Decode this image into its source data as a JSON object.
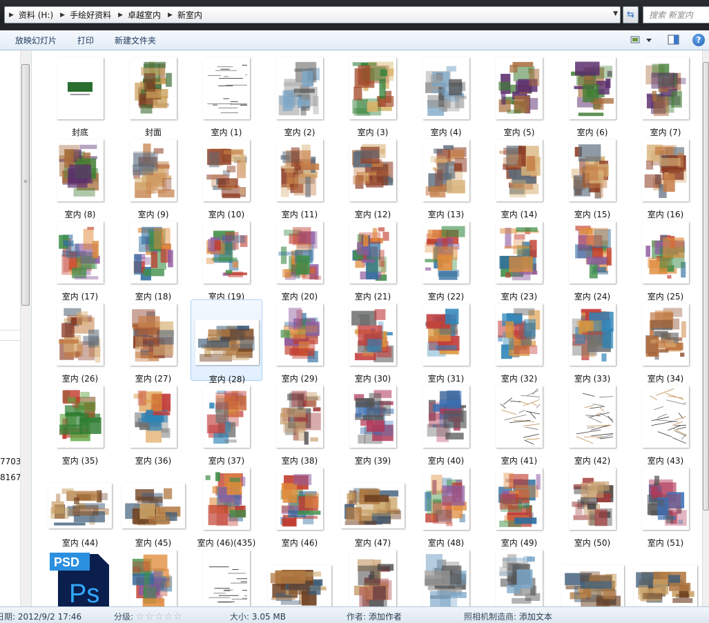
{
  "address": {
    "crumbs": [
      "资料 (H:)",
      "手绘好资料",
      "卓越室内",
      "新室内"
    ],
    "search_placeholder": "搜索 新室内"
  },
  "toolbar": {
    "slideshow": "放映幻灯片",
    "print": "打印",
    "new_folder": "新建文件夹",
    "help": "?"
  },
  "nav": {
    "numbers": [
      "7703",
      "8167"
    ]
  },
  "files": [
    {
      "name": "封底",
      "art": "cover"
    },
    {
      "name": "封面",
      "art": "front"
    },
    {
      "name": "室内 (1)",
      "art": "text"
    },
    {
      "name": "室内 (2)",
      "art": "sketch"
    },
    {
      "name": "室内 (3)",
      "art": "tree"
    },
    {
      "name": "室内 (4)",
      "art": "sketch"
    },
    {
      "name": "室内 (5)",
      "art": "garden"
    },
    {
      "name": "室内 (6)",
      "art": "garden"
    },
    {
      "name": "室内 (7)",
      "art": "garden"
    },
    {
      "name": "室内 (8)",
      "art": "garden"
    },
    {
      "name": "室内 (9)",
      "art": "room"
    },
    {
      "name": "室内 (10)",
      "art": "room"
    },
    {
      "name": "室内 (11)",
      "art": "room"
    },
    {
      "name": "室内 (12)",
      "art": "room"
    },
    {
      "name": "室内 (13)",
      "art": "room"
    },
    {
      "name": "室内 (14)",
      "art": "room"
    },
    {
      "name": "室内 (15)",
      "art": "room"
    },
    {
      "name": "室内 (16)",
      "art": "room"
    },
    {
      "name": "室内 (17)",
      "art": "color"
    },
    {
      "name": "室内 (18)",
      "art": "color"
    },
    {
      "name": "室内 (19)",
      "art": "color"
    },
    {
      "name": "室内 (20)",
      "art": "color"
    },
    {
      "name": "室内 (21)",
      "art": "color"
    },
    {
      "name": "室内 (22)",
      "art": "color"
    },
    {
      "name": "室内 (23)",
      "art": "color"
    },
    {
      "name": "室内 (24)",
      "art": "color"
    },
    {
      "name": "室内 (25)",
      "art": "color"
    },
    {
      "name": "室内 (26)",
      "art": "room"
    },
    {
      "name": "室内 (27)",
      "art": "room"
    },
    {
      "name": "室内 (28)",
      "art": "wide",
      "selected": true
    },
    {
      "name": "室内 (29)",
      "art": "color"
    },
    {
      "name": "室内 (30)",
      "art": "furniture"
    },
    {
      "name": "室内 (31)",
      "art": "furniture"
    },
    {
      "name": "室内 (32)",
      "art": "furniture"
    },
    {
      "name": "室内 (33)",
      "art": "furniture"
    },
    {
      "name": "室内 (34)",
      "art": "swatch"
    },
    {
      "name": "室内 (35)",
      "art": "plants"
    },
    {
      "name": "室内 (36)",
      "art": "furniture"
    },
    {
      "name": "室内 (37)",
      "art": "furniture"
    },
    {
      "name": "室内 (38)",
      "art": "plan"
    },
    {
      "name": "室内 (39)",
      "art": "elev"
    },
    {
      "name": "室内 (40)",
      "art": "elev"
    },
    {
      "name": "室内 (41)",
      "art": "lines"
    },
    {
      "name": "室内 (42)",
      "art": "lines"
    },
    {
      "name": "室内 (43)",
      "art": "lines"
    },
    {
      "name": "室内 (44)",
      "art": "wide"
    },
    {
      "name": "室内 (45)",
      "art": "wide"
    },
    {
      "name": "室内 (46)(435)",
      "art": "color"
    },
    {
      "name": "室内 (46)",
      "art": "color"
    },
    {
      "name": "室内 (47)",
      "art": "wide"
    },
    {
      "name": "室内 (48)",
      "art": "color"
    },
    {
      "name": "室内 (49)",
      "art": "color"
    },
    {
      "name": "室内 (50)",
      "art": "plan"
    },
    {
      "name": "室内 (51)",
      "art": "elev"
    },
    {
      "name": "",
      "art": "psd"
    },
    {
      "name": "",
      "art": "color"
    },
    {
      "name": "",
      "art": "text"
    },
    {
      "name": "",
      "art": "wide"
    },
    {
      "name": "",
      "art": "plan"
    },
    {
      "name": "",
      "art": "sketch"
    },
    {
      "name": "",
      "art": "sketch"
    },
    {
      "name": "",
      "art": "wide"
    },
    {
      "name": "",
      "art": "wide"
    }
  ],
  "psd_label": "PSD",
  "psd_logo": "Ps",
  "status": {
    "date_label": "日期:",
    "date_value": "2012/9/2 17:46",
    "rating_label": "分级:",
    "rating_stars": "☆☆☆☆☆",
    "size_label": "大小:",
    "size_value": "3.05 MB",
    "author_label": "作者:",
    "author_value": "添加作者",
    "camera_label": "照相机制造商:",
    "camera_value": "添加文本"
  },
  "colors": {
    "selection": "#e1efff",
    "selection_border": "#a8d0f3",
    "psd_blue": "#0a1f4d",
    "psd_cyan": "#31a8ff"
  }
}
